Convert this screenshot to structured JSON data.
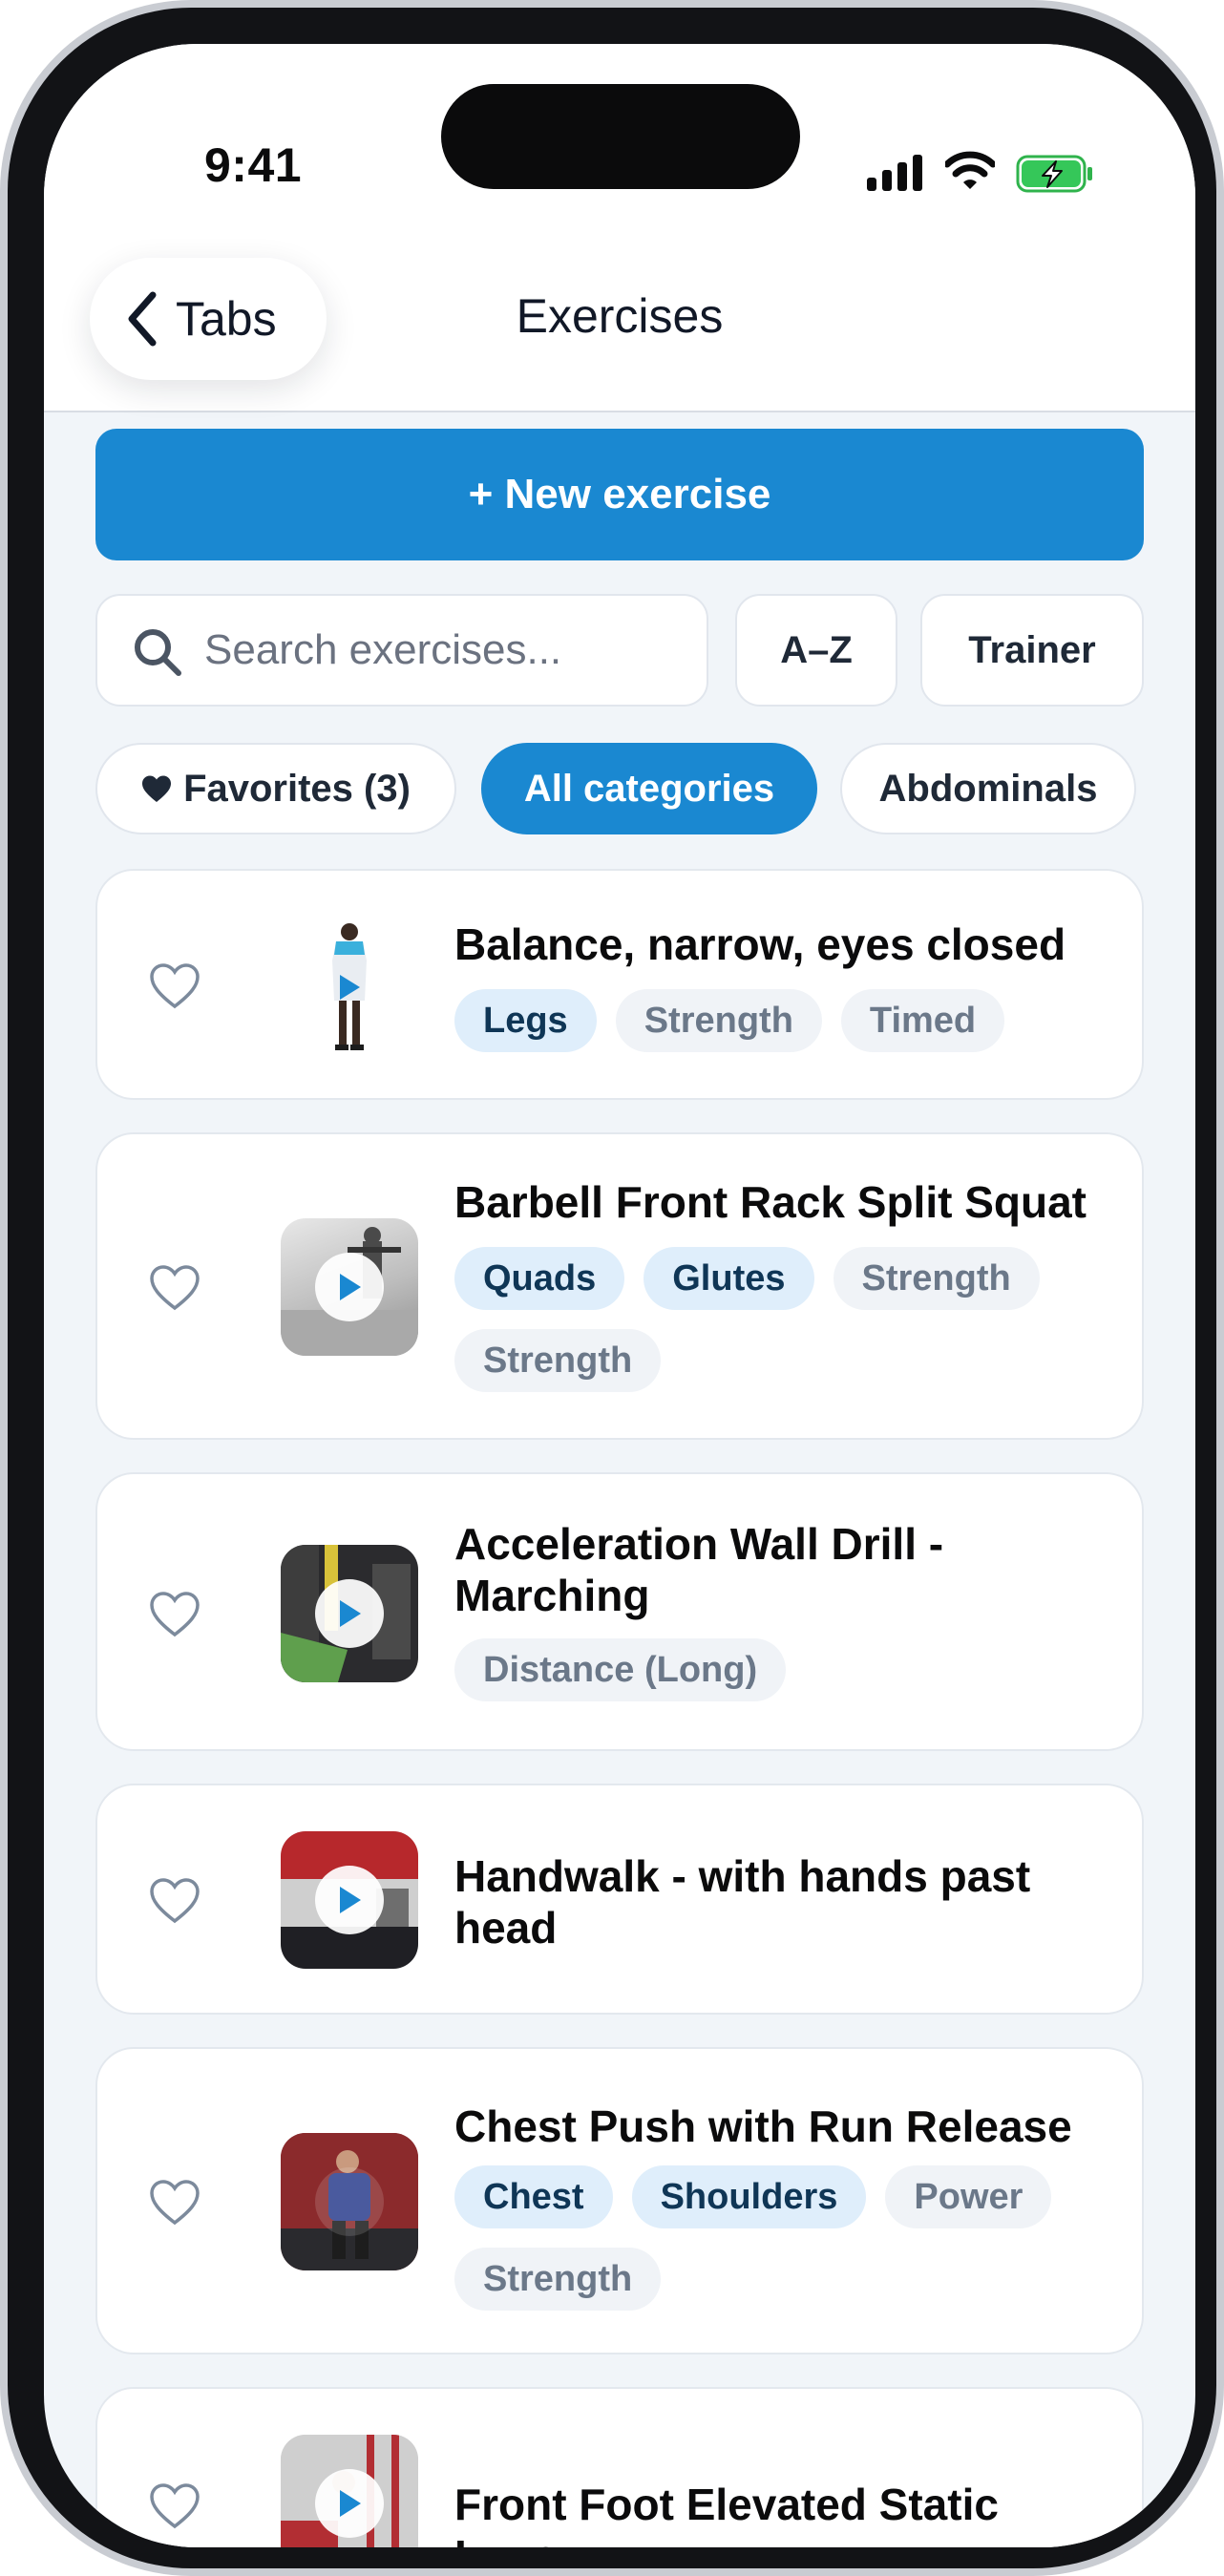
{
  "status_bar": {
    "time": "9:41"
  },
  "nav": {
    "back_label": "Tabs",
    "title": "Exercises"
  },
  "actions": {
    "new_exercise_label": "+ New exercise"
  },
  "search": {
    "placeholder": "Search exercises...",
    "sort_label": "A–Z",
    "trainer_label": "Trainer"
  },
  "filters": {
    "favorites_label": "Favorites (3)",
    "all_label": "All categories",
    "abdominals_label": "Abdominals"
  },
  "exercises": [
    {
      "title": "Balance, narrow, eyes closed",
      "primary_tags": [
        "Legs"
      ],
      "secondary_tags": [
        "Strength",
        "Timed"
      ]
    },
    {
      "title": "Barbell Front Rack Split Squat",
      "primary_tags": [
        "Quads",
        "Glutes"
      ],
      "secondary_tags": [
        "Strength",
        "Strength"
      ]
    },
    {
      "title": "Acceleration Wall Drill - Marching",
      "primary_tags": [],
      "secondary_tags": [
        "Distance (Long)"
      ]
    },
    {
      "title": "Handwalk - with hands past head",
      "primary_tags": [],
      "secondary_tags": []
    },
    {
      "title": "Chest Push with Run Release",
      "primary_tags": [
        "Chest",
        "Shoulders"
      ],
      "secondary_tags": [
        "Power",
        "Strength"
      ]
    },
    {
      "title": "Front Foot Elevated Static Lunge",
      "primary_tags": [],
      "secondary_tags": []
    }
  ],
  "colors": {
    "accent": "#1a88d1",
    "background": "#f1f5f9",
    "tag_primary_bg": "#dfeefb",
    "tag_secondary_bg": "#f0f3f7"
  },
  "icons": [
    "chevron-left-icon",
    "search-icon",
    "heart-filled-icon",
    "heart-outline-icon",
    "play-icon",
    "cellular-signal-icon",
    "wifi-icon",
    "battery-charging-icon"
  ]
}
